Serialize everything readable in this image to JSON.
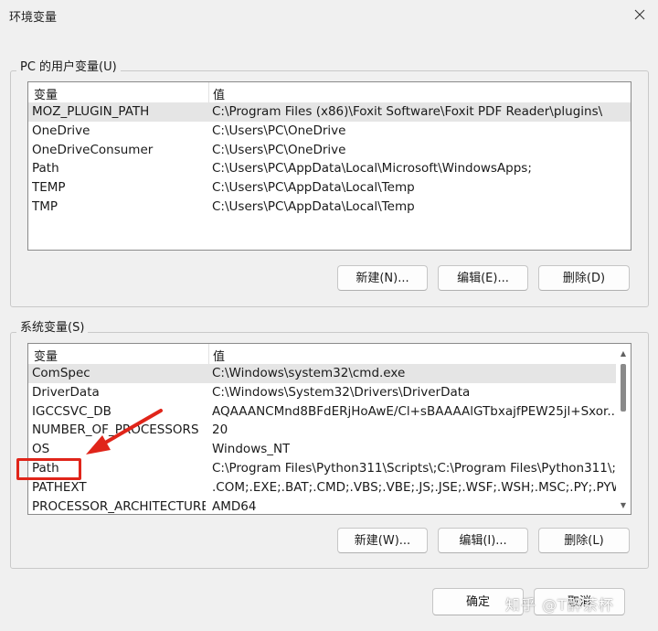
{
  "window": {
    "title": "环境变量",
    "close_icon": "close-icon"
  },
  "user_vars": {
    "group_label": "PC 的用户变量(U)",
    "col_variable": "变量",
    "col_value": "值",
    "rows": [
      {
        "name": "MOZ_PLUGIN_PATH",
        "value": "C:\\Program Files (x86)\\Foxit Software\\Foxit PDF Reader\\plugins\\",
        "selected": true
      },
      {
        "name": "OneDrive",
        "value": "C:\\Users\\PC\\OneDrive"
      },
      {
        "name": "OneDriveConsumer",
        "value": "C:\\Users\\PC\\OneDrive"
      },
      {
        "name": "Path",
        "value": "C:\\Users\\PC\\AppData\\Local\\Microsoft\\WindowsApps;"
      },
      {
        "name": "TEMP",
        "value": "C:\\Users\\PC\\AppData\\Local\\Temp"
      },
      {
        "name": "TMP",
        "value": "C:\\Users\\PC\\AppData\\Local\\Temp"
      }
    ],
    "buttons": {
      "new": "新建(N)...",
      "edit": "编辑(E)...",
      "delete": "删除(D)"
    }
  },
  "system_vars": {
    "group_label": "系统变量(S)",
    "col_variable": "变量",
    "col_value": "值",
    "rows": [
      {
        "name": "ComSpec",
        "value": "C:\\Windows\\system32\\cmd.exe",
        "selected": true
      },
      {
        "name": "DriverData",
        "value": "C:\\Windows\\System32\\Drivers\\DriverData"
      },
      {
        "name": "IGCCSVC_DB",
        "value": "AQAAANCMnd8BFdERjHoAwE/Cl+sBAAAAlGTbxajfPEW25jl+Sxor..."
      },
      {
        "name": "NUMBER_OF_PROCESSORS",
        "value": "20"
      },
      {
        "name": "OS",
        "value": "Windows_NT"
      },
      {
        "name": "Path",
        "value": "C:\\Program Files\\Python311\\Scripts\\;C:\\Program Files\\Python311\\;..."
      },
      {
        "name": "PATHEXT",
        "value": ".COM;.EXE;.BAT;.CMD;.VBS;.VBE;.JS;.JSE;.WSF;.WSH;.MSC;.PY;.PYW"
      },
      {
        "name": "PROCESSOR_ARCHITECTURE",
        "value": "AMD64"
      }
    ],
    "buttons": {
      "new": "新建(W)...",
      "edit": "编辑(I)...",
      "delete": "删除(L)"
    }
  },
  "footer": {
    "ok": "确定",
    "cancel": "取消"
  },
  "annotation": {
    "highlight_color": "#e0251a",
    "target": "Path"
  },
  "watermark": "知乎 @T醉茶杯"
}
